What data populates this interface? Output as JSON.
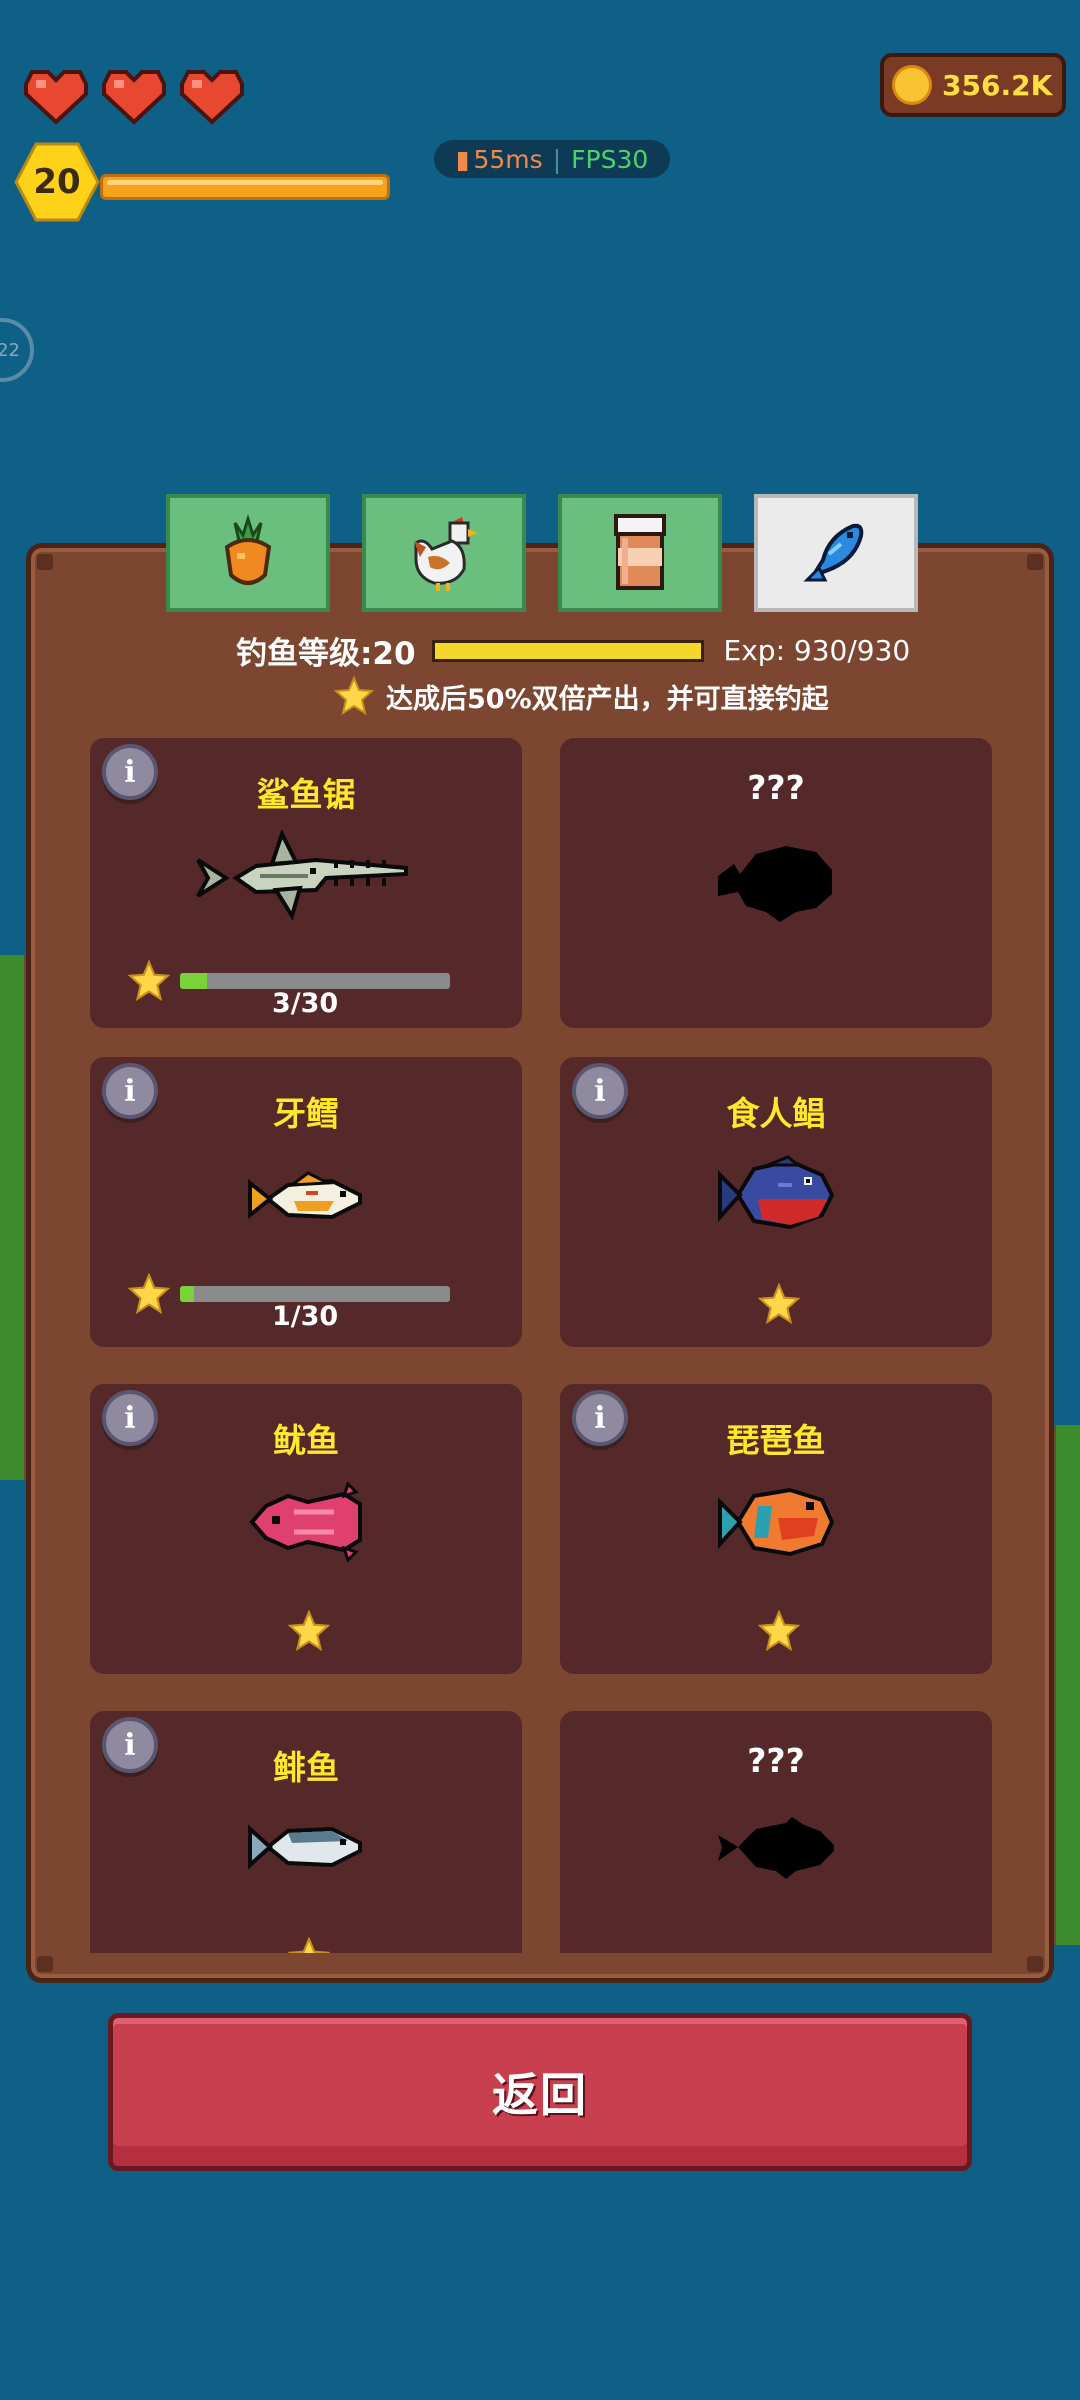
{
  "hud": {
    "hearts": 3,
    "player_level": "20",
    "xp_fill": 1.0,
    "ping": "55ms",
    "fps": "FPS30",
    "coins": "356.2K"
  },
  "tabs": [
    {
      "icon": "carrot-icon",
      "active": false
    },
    {
      "icon": "chicken-icon",
      "active": false
    },
    {
      "icon": "jar-icon",
      "active": false
    },
    {
      "icon": "fish-icon",
      "active": true
    }
  ],
  "fishing": {
    "level_label": "钓鱼等级:20",
    "exp_label": "Exp: 930/930",
    "exp_fill": 1.0,
    "bonus_text": "达成后50%双倍产出，并可直接钓起"
  },
  "fish_cards": [
    {
      "name": "鲨鱼锯",
      "known": true,
      "progress": "3/30",
      "fill": 0.1
    },
    {
      "name": "???",
      "known": false
    },
    {
      "name": "牙鳕",
      "known": true,
      "progress": "1/30",
      "fill": 0.05
    },
    {
      "name": "食人鲳",
      "known": true,
      "completed": true
    },
    {
      "name": "鱿鱼",
      "known": true,
      "completed": true
    },
    {
      "name": "琵琶鱼",
      "known": true,
      "completed": true
    },
    {
      "name": "鲱鱼",
      "known": true,
      "completed": true
    },
    {
      "name": "???",
      "known": false
    }
  ],
  "back_button": "返回",
  "colors": {
    "background": "#0f6087",
    "panel": "#7c4630",
    "card": "#55282a",
    "fish_name": "#ffe82a",
    "back_button": "#c84050"
  }
}
